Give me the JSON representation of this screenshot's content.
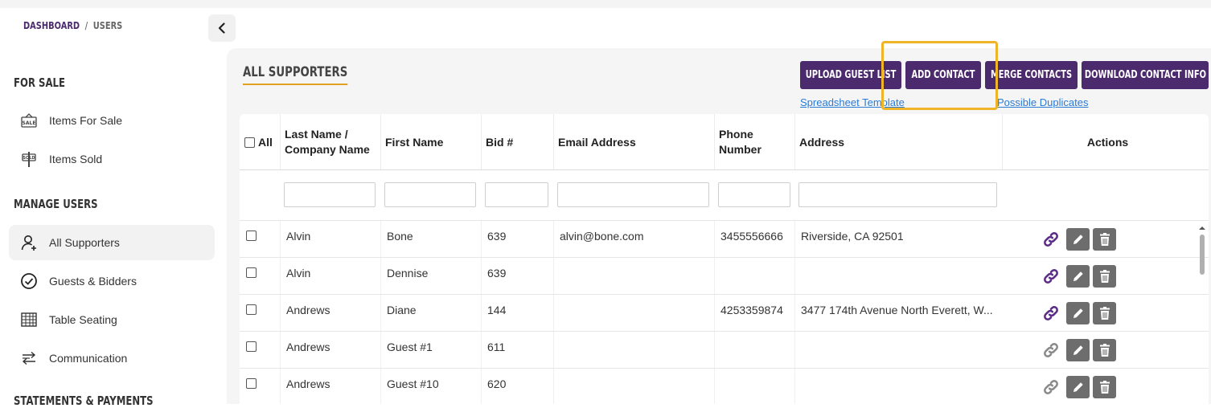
{
  "breadcrumb": {
    "dashboard": "DASHBOARD",
    "separator": "/",
    "users": "USERS"
  },
  "sidebar": {
    "for_sale_heading": "FOR SALE",
    "for_sale_items": [
      {
        "label": "Items For Sale",
        "icon": "sale-tag-icon"
      },
      {
        "label": "Items Sold",
        "icon": "sold-sign-icon"
      }
    ],
    "manage_users_heading": "MANAGE USERS",
    "manage_users_items": [
      {
        "label": "All Supporters",
        "icon": "user-plus-icon",
        "active": true
      },
      {
        "label": "Guests & Bidders",
        "icon": "check-circle-icon"
      },
      {
        "label": "Table Seating",
        "icon": "table-grid-icon"
      },
      {
        "label": "Communication",
        "icon": "arrows-exchange-icon"
      }
    ],
    "statements_heading": "STATEMENTS & PAYMENTS"
  },
  "main": {
    "title": "ALL SUPPORTERS",
    "buttons": {
      "upload": "UPLOAD GUEST LIST",
      "add": "ADD CONTACT",
      "merge": "MERGE CONTACTS",
      "download": "DOWNLOAD CONTACT INFO"
    },
    "links": {
      "template": "Spreadsheet Template",
      "duplicates": "Possible Duplicates"
    }
  },
  "table": {
    "headers": {
      "all": "All",
      "last_name": "Last Name / Company Name",
      "first_name": "First Name",
      "bid": "Bid #",
      "email": "Email Address",
      "phone": "Phone Number",
      "address": "Address",
      "actions": "Actions"
    },
    "rows": [
      {
        "last": "Alvin",
        "first": "Bone",
        "bid": "639",
        "email": "alvin@bone.com",
        "phone": "3455556666",
        "address": "Riverside, CA 92501",
        "linked": true
      },
      {
        "last": "Alvin",
        "first": "Dennise",
        "bid": "639",
        "email": "",
        "phone": "",
        "address": "",
        "linked": true
      },
      {
        "last": "Andrews",
        "first": "Diane",
        "bid": "144",
        "email": "",
        "phone": "4253359874",
        "address": "3477 174th Avenue North Everett, W...",
        "linked": true
      },
      {
        "last": "Andrews",
        "first": "Guest #1",
        "bid": "611",
        "email": "",
        "phone": "",
        "address": "",
        "linked": false
      },
      {
        "last": "Andrews",
        "first": "Guest #10",
        "bid": "620",
        "email": "",
        "phone": "",
        "address": "",
        "linked": false
      }
    ]
  },
  "colors": {
    "brand_purple": "#4b2b6d",
    "accent_gold": "#e0a321",
    "link_blue": "#2a7bd6",
    "action_gray": "#6d6d6d",
    "link_icon_purple": "#5b2d86"
  }
}
